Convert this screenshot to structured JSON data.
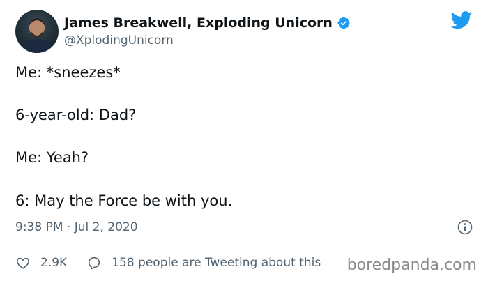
{
  "author": {
    "display_name": "James Breakwell, Exploding Unicorn",
    "handle": "@XplodingUnicorn",
    "verified_icon": "verified-badge-icon",
    "avatar_icon": "avatar-photo"
  },
  "platform_icon": "twitter-bird-icon",
  "tweet": {
    "lines": [
      "Me: *sneezes*",
      "6-year-old: Dad?",
      "Me: Yeah?",
      "6: May the Force be with you."
    ],
    "timestamp": "9:38 PM · Jul 2, 2020",
    "info_icon": "info-icon"
  },
  "engagement": {
    "likes": "2.9K",
    "like_icon": "heart-icon",
    "reply_text": "158 people are Tweeting about this",
    "reply_icon": "speech-bubble-icon"
  },
  "watermark": "boredpanda.com",
  "colors": {
    "text": "#0f1419",
    "secondary": "#536471",
    "twitter_blue": "#1d9bf0",
    "divider": "#cfd9de"
  }
}
